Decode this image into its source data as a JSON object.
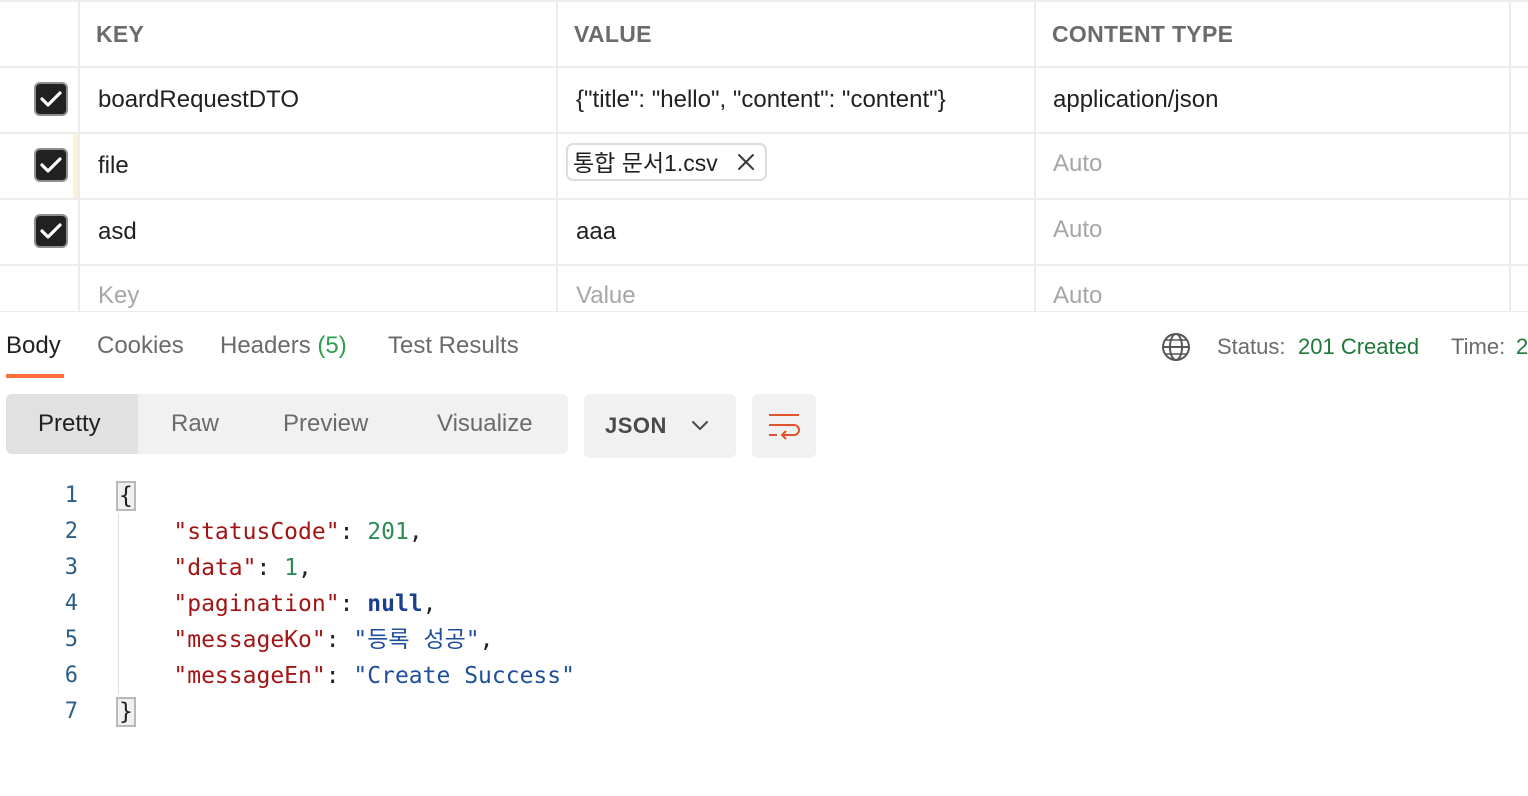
{
  "params_table": {
    "headers": [
      "KEY",
      "VALUE",
      "CONTENT TYPE"
    ],
    "rows": [
      {
        "checked": true,
        "key": "boardRequestDTO",
        "value": "{\"title\": \"hello\", \"content\": \"content\"}",
        "content_type": "application/json"
      },
      {
        "checked": true,
        "key": "file",
        "file_value": "통합 문서1.csv",
        "content_type": "Auto"
      },
      {
        "checked": true,
        "key": "asd",
        "value": "aaa",
        "content_type": "Auto"
      }
    ],
    "new_row": {
      "key_placeholder": "Key",
      "value_placeholder": "Value",
      "content_type_placeholder": "Auto"
    }
  },
  "response_tabs": {
    "body": "Body",
    "cookies": "Cookies",
    "headers": "Headers",
    "headers_count": "(5)",
    "test_results": "Test Results",
    "active": "Body"
  },
  "status": {
    "label": "Status:",
    "value": "201 Created",
    "time_label": "Time:",
    "time_value_partial": "2"
  },
  "view_modes": {
    "items": [
      "Pretty",
      "Raw",
      "Preview",
      "Visualize"
    ],
    "active": "Pretty"
  },
  "format_select": {
    "selected": "JSON"
  },
  "icons": {
    "checkbox": "check-icon",
    "remove_file": "close-icon",
    "network": "globe-icon",
    "format_dropdown": "chevron-down-icon",
    "wrap": "wrap-lines-icon"
  },
  "code": {
    "line_numbers": [
      "1",
      "2",
      "3",
      "4",
      "5",
      "6",
      "7"
    ],
    "open_brace": "{",
    "close_brace": "}",
    "fields": [
      {
        "key": "\"statusCode\"",
        "value": "201",
        "type": "number",
        "trail": ","
      },
      {
        "key": "\"data\"",
        "value": "1",
        "type": "number",
        "trail": ","
      },
      {
        "key": "\"pagination\"",
        "value": "null",
        "type": "keyword",
        "trail": ","
      },
      {
        "key": "\"messageKo\"",
        "value": "\"등록 성공\"",
        "type": "string",
        "trail": ","
      },
      {
        "key": "\"messageEn\"",
        "value": "\"Create Success\"",
        "type": "string",
        "trail": ""
      }
    ]
  },
  "colors": {
    "accent": "#ff6c37",
    "status_ok": "#1f7a3a",
    "json_key": "#a31515",
    "json_number": "#2e8b57",
    "json_string": "#1f4f9a"
  }
}
